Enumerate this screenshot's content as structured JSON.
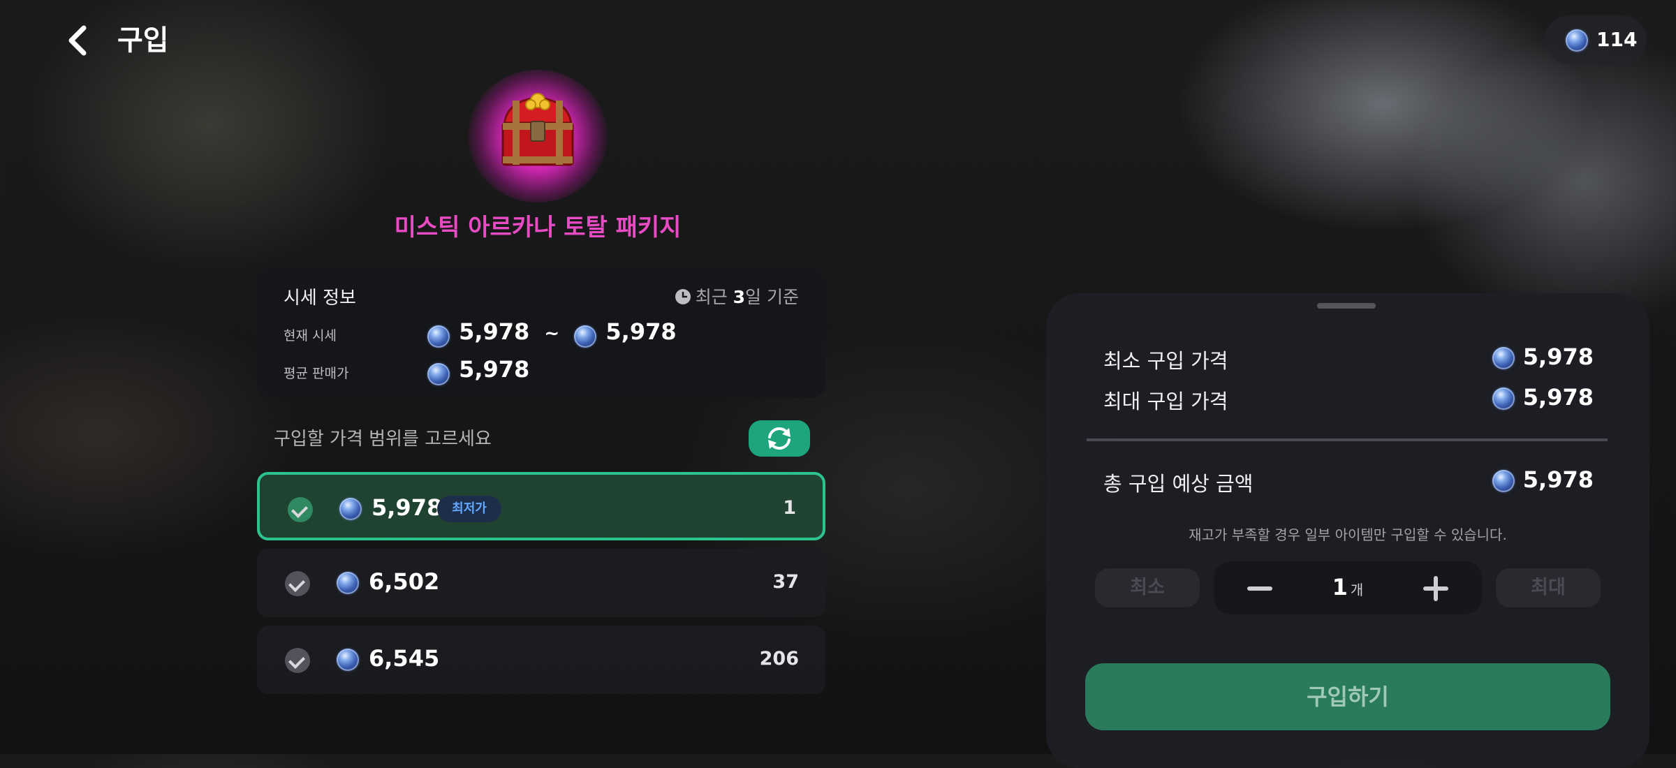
{
  "header": {
    "title": "구입",
    "currency_balance": "114"
  },
  "item": {
    "name": "미스틱 아르카나 토탈 패키지",
    "name_color": "#e84bc4"
  },
  "price_info": {
    "title": "시세 정보",
    "period_prefix": "최근 ",
    "period_days": "3",
    "period_suffix": "일 기준",
    "current_label": "현재 시세",
    "current_min": "5,978",
    "range_sep": "~",
    "current_max": "5,978",
    "avg_label": "평균 판매가",
    "avg_value": "5,978"
  },
  "selection": {
    "prompt": "구입할 가격 범위를 고르세요",
    "options": [
      {
        "price": "5,978",
        "badge": "최저가",
        "qty": "1",
        "selected": true
      },
      {
        "price": "6,502",
        "badge": "",
        "qty": "37",
        "selected": false
      },
      {
        "price": "6,545",
        "badge": "",
        "qty": "206",
        "selected": false
      }
    ]
  },
  "summary": {
    "min_label": "최소 구입 가격",
    "min_value": "5,978",
    "max_label": "최대 구입 가격",
    "max_value": "5,978",
    "total_label": "총 구입 예상 금액",
    "total_value": "5,978",
    "notice": "재고가 부족할 경우 일부 아이템만 구입할 수 있습니다.",
    "min_btn": "최소",
    "max_btn": "최대",
    "quantity": "1",
    "quantity_unit": "개",
    "buy_label": "구입하기"
  },
  "colors": {
    "accent_green": "#2dc38e",
    "badge_blue": "#63a8ff"
  }
}
